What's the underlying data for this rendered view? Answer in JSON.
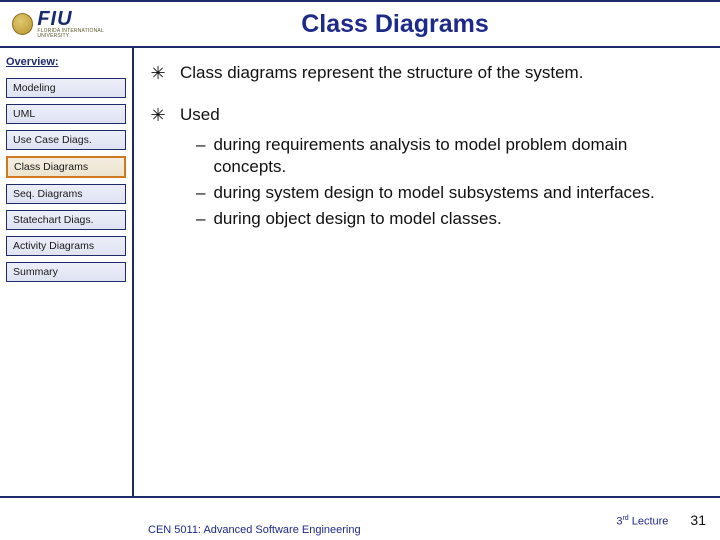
{
  "header": {
    "logo_main": "FIU",
    "logo_sub": "FLORIDA INTERNATIONAL UNIVERSITY",
    "title": "Class Diagrams"
  },
  "sidebar": {
    "label": "Overview:",
    "items": [
      {
        "label": "Modeling",
        "active": false
      },
      {
        "label": "UML",
        "active": false
      },
      {
        "label": "Use Case Diags.",
        "active": false
      },
      {
        "label": "Class Diagrams",
        "active": true
      },
      {
        "label": "Seq. Diagrams",
        "active": false
      },
      {
        "label": "Statechart Diags.",
        "active": false
      },
      {
        "label": "Activity Diagrams",
        "active": false
      },
      {
        "label": "Summary",
        "active": false
      }
    ]
  },
  "content": {
    "bullet1": "Class diagrams represent the structure of the system.",
    "bullet2": "Used",
    "subs": [
      "during requirements analysis to model problem domain concepts.",
      "during system design to model subsystems and interfaces.",
      "during object design to model classes."
    ]
  },
  "footer": {
    "left": "CEN 5011: Advanced Software Engineering",
    "right_ord": "3",
    "right_sup": "rd",
    "right_word": " Lecture",
    "page": "31"
  }
}
